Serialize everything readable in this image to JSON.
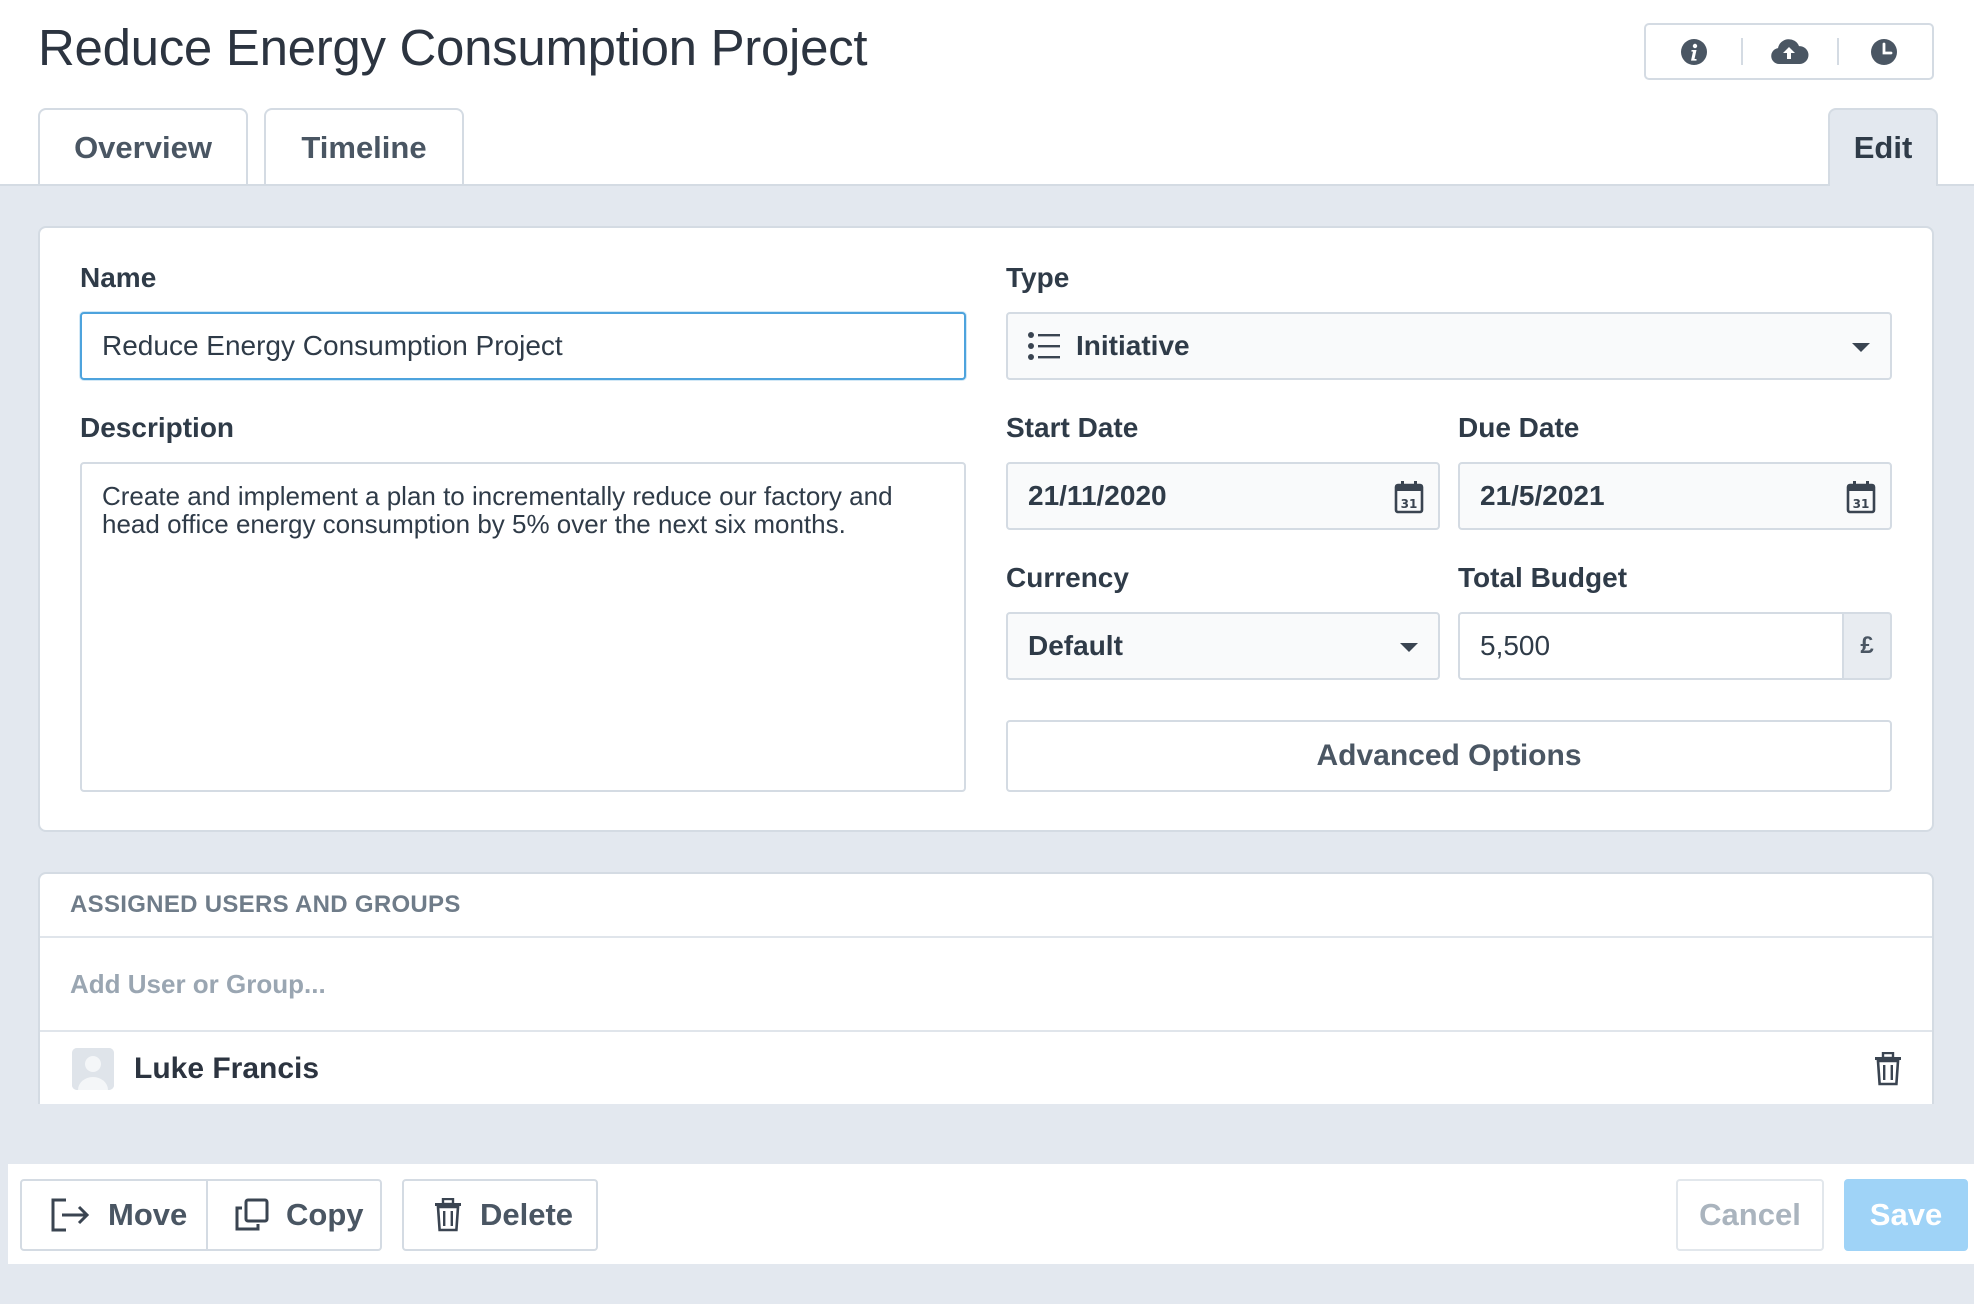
{
  "page": {
    "title": "Reduce Energy Consumption Project"
  },
  "header_actions": [
    {
      "icon": "info-icon"
    },
    {
      "icon": "cloud-upload-icon"
    },
    {
      "icon": "clock-icon"
    }
  ],
  "tabs": [
    {
      "label": "Overview",
      "active": false
    },
    {
      "label": "Timeline",
      "active": false
    },
    {
      "label": "Edit",
      "active": true
    }
  ],
  "form": {
    "name": {
      "label": "Name",
      "value": "Reduce Energy Consumption Project"
    },
    "type": {
      "label": "Type",
      "value": "Initiative",
      "icon": "list-icon"
    },
    "description": {
      "label": "Description",
      "value": "Create and implement a plan to incrementally reduce our factory and head office energy consumption by 5% over the next six months."
    },
    "start_date": {
      "label": "Start Date",
      "value": "21/11/2020",
      "icon": "calendar-icon"
    },
    "due_date": {
      "label": "Due Date",
      "value": "21/5/2021",
      "icon": "calendar-icon"
    },
    "currency": {
      "label": "Currency",
      "value": "Default"
    },
    "total_budget": {
      "label": "Total Budget",
      "value": "5,500",
      "unit": "£"
    },
    "advanced_options_label": "Advanced Options"
  },
  "assigned": {
    "header": "ASSIGNED USERS AND GROUPS",
    "add_placeholder": "Add User or Group...",
    "users": [
      {
        "name": "Luke Francis"
      }
    ]
  },
  "footer": {
    "move_label": "Move",
    "copy_label": "Copy",
    "delete_label": "Delete",
    "cancel_label": "Cancel",
    "save_label": "Save"
  },
  "colors": {
    "accent": "#4da3dd",
    "save_button": "#9fd3f7",
    "background": "#e3e8ef",
    "border": "#d4dbe3"
  }
}
